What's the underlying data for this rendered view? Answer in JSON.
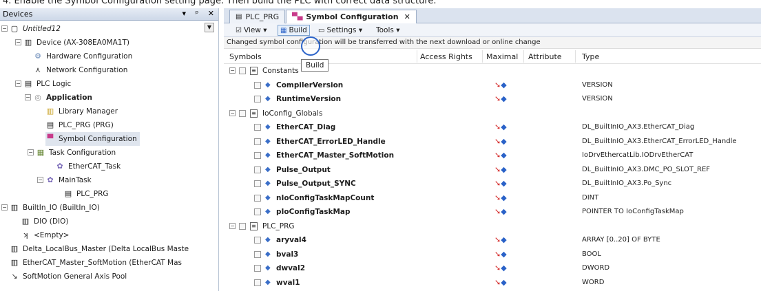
{
  "banner": {
    "text": "4. Enable the Symbol Configuration setting page. Then build the PLC with correct data structure."
  },
  "devices_pane": {
    "title": "Devices",
    "header_controls": [
      "▾",
      "ᵖ",
      "✕"
    ],
    "tree": [
      {
        "label": "Untitled12",
        "icon": "project-icon",
        "italic": true
      },
      {
        "label": "Device (AX-308EA0MA1T)",
        "icon": "device-icon"
      },
      {
        "label": "Hardware Configuration",
        "icon": "hardware-config-icon"
      },
      {
        "label": "Network Configuration",
        "icon": "network-config-icon"
      },
      {
        "label": "PLC Logic",
        "icon": "plc-logic-icon"
      },
      {
        "label": "Application",
        "icon": "application-icon",
        "bold": true
      },
      {
        "label": "Library Manager",
        "icon": "library-icon"
      },
      {
        "label": "PLC_PRG (PRG)",
        "icon": "pou-icon"
      },
      {
        "label": "Symbol Configuration",
        "icon": "symbol-config-icon",
        "selected": true
      },
      {
        "label": "Task Configuration",
        "icon": "task-config-icon"
      },
      {
        "label": "EtherCAT_Task",
        "icon": "task-icon"
      },
      {
        "label": "MainTask",
        "icon": "task-icon"
      },
      {
        "label": "PLC_PRG",
        "icon": "pou-call-icon"
      },
      {
        "label": "BuiltIn_IO (BuiltIn_IO)",
        "icon": "io-icon"
      },
      {
        "label": "DIO (DIO)",
        "icon": "io-icon"
      },
      {
        "label": "<Empty>",
        "icon": "empty-slot-icon"
      },
      {
        "label": "Delta_LocalBus_Master (Delta LocalBus Maste",
        "icon": "io-icon"
      },
      {
        "label": "EtherCAT_Master_SoftMotion (EtherCAT Mas",
        "icon": "io-icon"
      },
      {
        "label": "SoftMotion General Axis Pool",
        "icon": "axis-pool-icon"
      }
    ]
  },
  "editor": {
    "tabs": [
      {
        "label": "PLC_PRG",
        "active": false
      },
      {
        "label": "Symbol Configuration",
        "active": true,
        "close": "✕"
      }
    ],
    "toolbar": {
      "view": "View ▾",
      "build": "Build",
      "settings": "Settings ▾",
      "tools": "Tools ▾"
    },
    "info_text": "Changed symbol configuration will be transferred with the next download or online change",
    "tooltip": "Build",
    "columns": [
      "Symbols",
      "Access Rights",
      "Maximal",
      "Attribute",
      "Type"
    ],
    "rows": [
      {
        "kind": "group",
        "name": "Constants"
      },
      {
        "kind": "item",
        "name": "CompilerVersion",
        "type": "VERSION"
      },
      {
        "kind": "item",
        "name": "RuntimeVersion",
        "type": "VERSION"
      },
      {
        "kind": "group",
        "name": "IoConfig_Globals"
      },
      {
        "kind": "item",
        "name": "EtherCAT_Diag",
        "type": "DL_BuiltInIO_AX3.EtherCAT_Diag"
      },
      {
        "kind": "item",
        "name": "EtherCAT_ErrorLED_Handle",
        "type": "DL_BuiltInIO_AX3.EtherCAT_ErrorLED_Handle"
      },
      {
        "kind": "item",
        "name": "EtherCAT_Master_SoftMotion",
        "type": "IoDrvEthercatLib.IODrvEtherCAT"
      },
      {
        "kind": "item",
        "name": "Pulse_Output",
        "type": "DL_BuiltInIO_AX3.DMC_PO_SLOT_REF"
      },
      {
        "kind": "item",
        "name": "Pulse_Output_SYNC",
        "type": "DL_BuiltInIO_AX3.Po_Sync"
      },
      {
        "kind": "item",
        "name": "nIoConfigTaskMapCount",
        "type": "DINT"
      },
      {
        "kind": "item",
        "name": "pIoConfigTaskMap",
        "type": "POINTER TO IoConfigTaskMap"
      },
      {
        "kind": "group",
        "name": "PLC_PRG"
      },
      {
        "kind": "item",
        "name": "aryval4",
        "type": "ARRAY [0..20] OF BYTE"
      },
      {
        "kind": "item",
        "name": "bval3",
        "type": "BOOL"
      },
      {
        "kind": "item",
        "name": "dwval2",
        "type": "DWORD"
      },
      {
        "kind": "item",
        "name": "wval1",
        "type": "WORD"
      }
    ]
  },
  "colors": {
    "selection": "#dfe5ee",
    "header_bg": "#dbe3ef",
    "accent": "#2a62c8"
  }
}
